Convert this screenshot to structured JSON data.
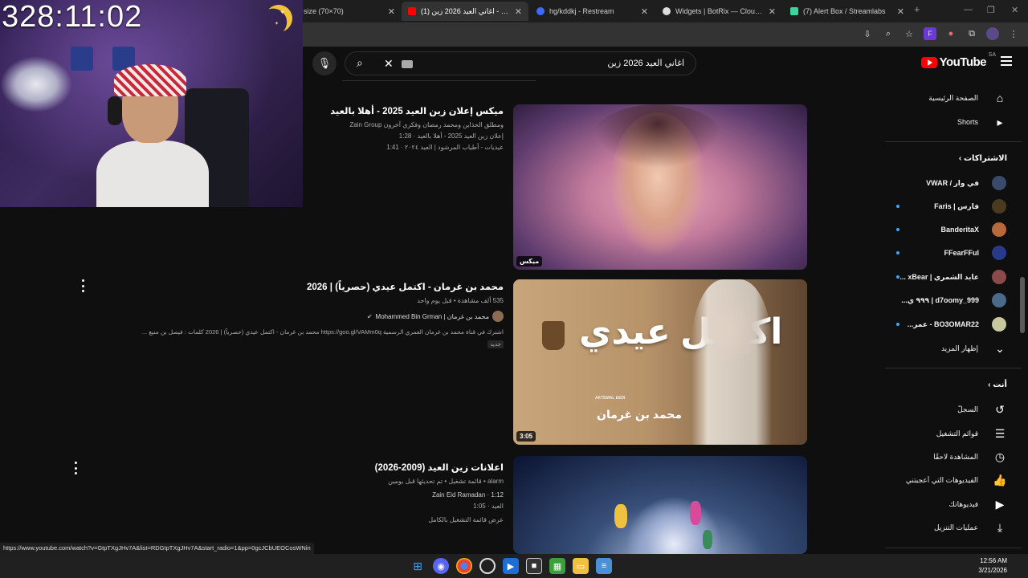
{
  "browser": {
    "tabs": [
      {
        "title": "size (70×70)",
        "active": false
      },
      {
        "title": "(1) اغاني العيد 2026 زين - YouTube",
        "active": true
      },
      {
        "title": "hg/kddkj - Restream",
        "active": false
      },
      {
        "title": "Widgets | BotRix — Cloud Strea...",
        "active": false
      },
      {
        "title": "(7) Alert Box / Streamlabs",
        "active": false
      }
    ],
    "new_tab": "+",
    "close_glyph": "✕"
  },
  "youtube": {
    "logo_word": "YouTube",
    "country": "SA",
    "search_query": "اغاني العيد 2026 زين"
  },
  "sidebar": {
    "main": [
      {
        "label": "الصفحة الرئيسية",
        "icon": "home-icon"
      },
      {
        "label": "Shorts",
        "icon": "shorts-icon"
      }
    ],
    "subs_heading": "الاشتراكات",
    "subs": [
      {
        "label": "في وار / VWAR",
        "dot": false,
        "color": "#3a4a6a"
      },
      {
        "label": "فارس | Faris",
        "dot": true,
        "color": "#4a3a20"
      },
      {
        "label": "BanderitaX",
        "dot": true,
        "color": "#b8683a"
      },
      {
        "label": "FFearFFul",
        "dot": true,
        "color": "#2a3a8a"
      },
      {
        "label": "عابد الشمري | xBear ...",
        "dot": true,
        "color": "#8a4a4a"
      },
      {
        "label": "d7oomy_999 | ٩٩٩ ي...",
        "dot": false,
        "color": "#4a6a8a"
      },
      {
        "label": "BO3OMAR22 - عمر...",
        "dot": true,
        "color": "#c8c8a0"
      }
    ],
    "show_more": "إظهار المزيد",
    "you_heading": "أنت",
    "you": [
      {
        "label": "السجلّ",
        "icon": "history-icon"
      },
      {
        "label": "قوائم التشغيل",
        "icon": "playlists-icon"
      },
      {
        "label": "المشاهدة لاحقًا",
        "icon": "watch-later-icon"
      },
      {
        "label": "الفيديوهات التي أعجبتني",
        "icon": "liked-icon"
      },
      {
        "label": "فيديوهاتك",
        "icon": "your-videos-icon"
      },
      {
        "label": "عمليات التنزيل",
        "icon": "download-icon"
      }
    ]
  },
  "results": [
    {
      "title": "ميكس إعلان زين العيد 2025 - أهلا بالعيد",
      "line1": "ومطلق الحذاين ومحمد رمضان وفكري آخرون Zain Group",
      "line2": "إعلان زين العيد 2025 - أهلا بالعيد · 1:28",
      "line3": "عيديات - أطياب المرشود | العيد ٢٠٢٤ · 1:41",
      "badge": "ميكس"
    },
    {
      "title": "محمد بن غرمان - اكتمل عيدي (حصرياً) | 2026",
      "views": "535 ألف مشاهدة • قبل يوم واحد",
      "channel": "محمد بن غرمان | Mohammed Bin Grman",
      "desc": "اشترك في قناة محمد بن غرمان العمري الرسمية https://goo.gl/VAMm0q محمد بن غرمان - اكتمل عيدي (حصرياً) | 2026 كلمات : فيصل بن منيع ...",
      "tag": "جديد",
      "duration": "3:05",
      "thumb_text": "اكتمل عيدي",
      "thumb_sub": "محمد بن غرمان",
      "thumb_small": "AKTEMAL EEDI"
    },
    {
      "title": "اعلانات زين العيد (2009-2026)",
      "line1": "alarm • قائمة تشغيل • تم تحديثها قبل يومين",
      "line2": "Zain Eid Ramadan · 1:12",
      "line3": "العيد · 1:05",
      "line4": "عرض قائمة التشغيل بالكامل"
    }
  ],
  "stream_overlay": {
    "timer": "328:11:02"
  },
  "status_url": "https://www.youtube.com/watch?v=GtpTXgJHv7A&list=RDGtpTXgJHv7A&start_radio=1&pp=0gcJCbUEOCosWNin",
  "clock": {
    "time": "12:56 AM",
    "date": "3/21/2026"
  }
}
